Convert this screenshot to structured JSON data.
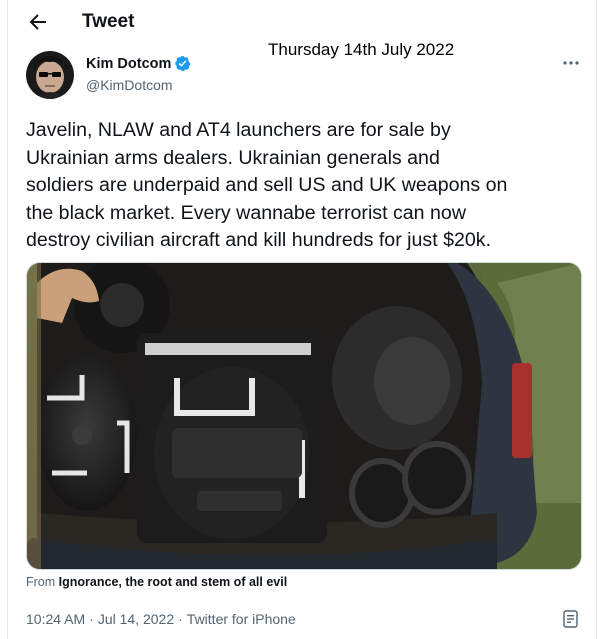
{
  "header": {
    "title": "Tweet",
    "back_icon": "arrow-left-icon"
  },
  "overlay": {
    "date": "Thursday 14th July 2022"
  },
  "author": {
    "name": "Kim Dotcom",
    "handle": "@KimDotcom",
    "verified": true,
    "verified_color": "#1d9bf0"
  },
  "tweet": {
    "lines": [
      "Javelin, NLAW and AT4 launchers are for sale by",
      "Ukrainian arms dealers. Ukrainian generals and",
      "soldiers are underpaid and sell US and UK weapons on",
      "the black market. Every wannabe terrorist can now",
      "destroy civilian aircraft and kill hundreds for just $20k."
    ],
    "source_prefix": "From",
    "source_name": "Ignorance, the root and stem of all evil",
    "time": "10:24 AM",
    "date": "Jul 14, 2022",
    "client": "Twitter for iPhone",
    "separator": "·"
  },
  "colors": {
    "text": "#0f1419",
    "secondary": "#536471",
    "border": "#cfd9de"
  }
}
